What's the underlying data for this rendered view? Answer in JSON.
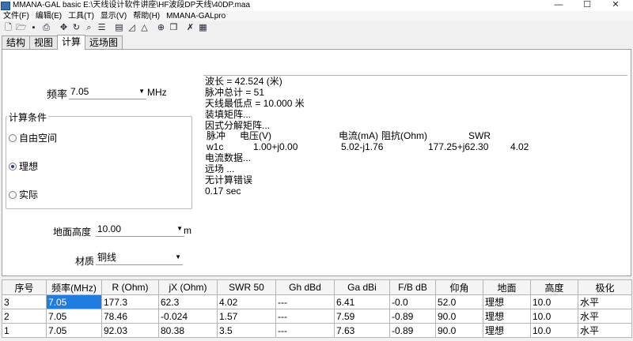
{
  "window": {
    "title": "MMANA-GAL basic E:\\天线设计软件讲座\\HF波段DP天线\\40DP.maa",
    "minimize": "—",
    "maximize": "☐",
    "close": "✕"
  },
  "menu": [
    "文件(F)",
    "编辑(E)",
    "工具(T)",
    "显示(V)",
    "帮助(H)",
    "MMANA-GALpro"
  ],
  "toolbar": {
    "icons": [
      "new-file-icon",
      "open-folder-icon",
      "save-icon",
      "print-icon",
      "move-icon",
      "rotate-icon",
      "zoom-icon",
      "wire-edit-icon",
      "document-icon",
      "diagram-icon",
      "triangle-icon",
      "target-icon",
      "copy-icon",
      "tools-icon",
      "calculator-icon"
    ]
  },
  "tabs": [
    "结构",
    "视图",
    "计算",
    "远场图"
  ],
  "frequency": {
    "label": "频率",
    "value": "7.05",
    "unit": "MHz"
  },
  "conditions": {
    "title": "计算条件",
    "free_space": "自由空间",
    "ideal": "理想",
    "real": "实际",
    "selected": "理想"
  },
  "ground_height": {
    "label": "地面高度",
    "value": "10.00",
    "unit": "m"
  },
  "material": {
    "label": "材质",
    "value": "铜线"
  },
  "output": {
    "wavelength": "波长 = 42.524 (米)",
    "pulses": "脉冲总计 = 51",
    "lowest_point": "天线最低点 = 10.000 米",
    "fill_matrix": "装填矩阵...",
    "factorize": "因式分解矩阵...",
    "header": {
      "pulse": "脉冲",
      "voltage": "电压(V)",
      "current": "电流(mA)",
      "impedance": "阻抗(Ohm)",
      "swr": "SWR"
    },
    "row": {
      "pulse": "w1c",
      "voltage": "1.00+j0.00",
      "current": "5.02-j1.76",
      "impedance": "177.25+j62.30",
      "swr": "4.02"
    },
    "current_data": "电流数据...",
    "far_field": "远场 ...",
    "no_error": "无计算错误",
    "time": "0.17 sec"
  },
  "table": {
    "headers": [
      "序号",
      "频率(MHz)",
      "R (Ohm)",
      "jX (Ohm)",
      "SWR 50",
      "Gh dBd",
      "Ga dBi",
      "F/B dB",
      "仰角",
      "地面",
      "高度",
      "极化"
    ],
    "rows": [
      [
        "3",
        "7.05",
        "177.3",
        "62.3",
        "4.02",
        "---",
        "6.41",
        "-0.0",
        "52.0",
        "理想",
        "10.0",
        "水平"
      ],
      [
        "2",
        "7.05",
        "78.46",
        "-0.024",
        "1.57",
        "---",
        "7.59",
        "-0.89",
        "90.0",
        "理想",
        "10.0",
        "水平"
      ],
      [
        "1",
        "7.05",
        "92.03",
        "80.38",
        "3.5",
        "---",
        "7.63",
        "-0.89",
        "90.0",
        "理想",
        "10.0",
        "水平"
      ]
    ]
  }
}
